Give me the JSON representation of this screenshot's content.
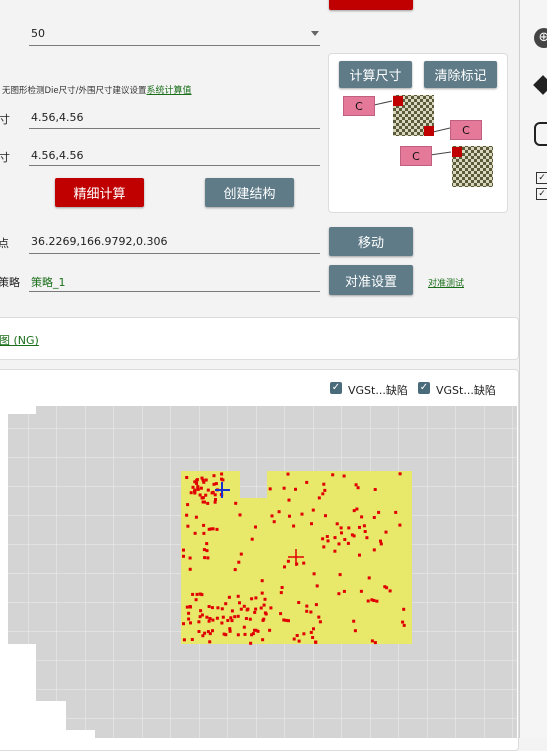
{
  "form": {
    "top_select_value": "50",
    "note_text": "无图形检测Die尺寸/外围尺寸建议设置",
    "note_link": "系统计算值",
    "size1_label": "尺寸",
    "size1_value": "4.56,4.56",
    "size2_label": "尺寸",
    "size2_value": "4.56,4.56",
    "fine_calc_label": "精细计算",
    "create_struct_label": "创建结构",
    "point_label": "点",
    "point_value": "36.2269,166.9792,0.306",
    "move_label": "移动",
    "strategy_label": "策略",
    "strategy_value": "策略_1",
    "align_setup_label": "对准设置",
    "align_test_label": "对准测试"
  },
  "calc_panel": {
    "calc_size_label": "计算尺寸",
    "clear_marks_label": "清除标记",
    "c_label": "C"
  },
  "map_link": {
    "label": "图 (NG)"
  },
  "wafer_view": {
    "checkbox1_label": "VGSt...缺陷",
    "checkbox2_label": "VGSt...缺陷",
    "colors": {
      "die_grey": "#d4d4d4",
      "region_yellow": "#e8e86a",
      "defect_red": "#e00000",
      "cross_blue": "#1a2fd0",
      "cross_red": "#e00000"
    }
  }
}
